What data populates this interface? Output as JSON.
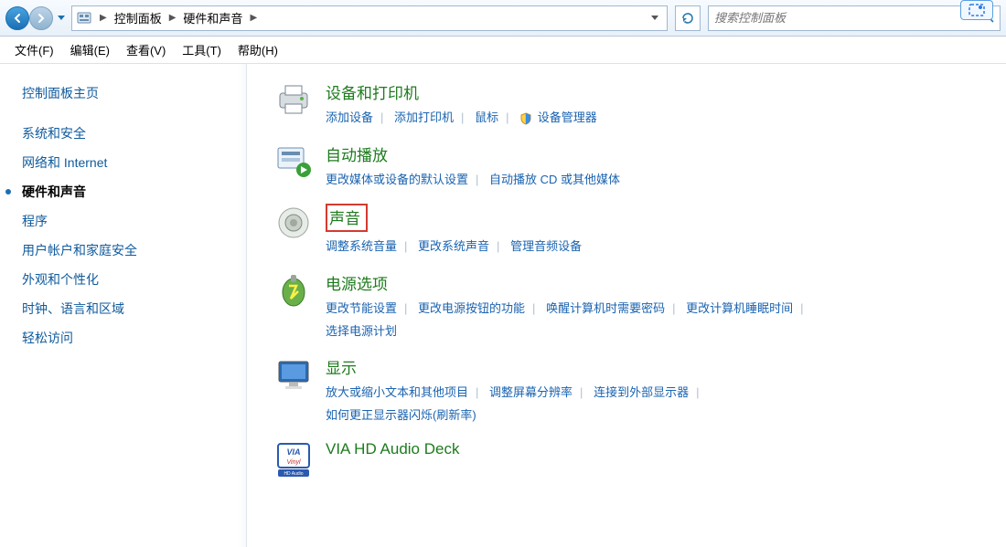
{
  "breadcrumb": {
    "items": [
      "控制面板",
      "硬件和声音"
    ]
  },
  "search": {
    "placeholder": "搜索控制面板"
  },
  "menubar": [
    "文件(F)",
    "编辑(E)",
    "查看(V)",
    "工具(T)",
    "帮助(H)"
  ],
  "sidebar": {
    "items": [
      {
        "label": "控制面板主页",
        "active": false
      },
      {
        "label": "系统和安全",
        "active": false
      },
      {
        "label": "网络和 Internet",
        "active": false
      },
      {
        "label": "硬件和声音",
        "active": true
      },
      {
        "label": "程序",
        "active": false
      },
      {
        "label": "用户帐户和家庭安全",
        "active": false
      },
      {
        "label": "外观和个性化",
        "active": false
      },
      {
        "label": "时钟、语言和区域",
        "active": false
      },
      {
        "label": "轻松访问",
        "active": false
      }
    ]
  },
  "categories": [
    {
      "icon": "printer-icon",
      "title": "设备和打印机",
      "highlighted": false,
      "links": [
        {
          "label": "添加设备"
        },
        {
          "label": "添加打印机"
        },
        {
          "label": "鼠标"
        },
        {
          "label": "设备管理器",
          "shield": true
        }
      ]
    },
    {
      "icon": "autoplay-icon",
      "title": "自动播放",
      "highlighted": false,
      "links": [
        {
          "label": "更改媒体或设备的默认设置"
        },
        {
          "label": "自动播放 CD 或其他媒体"
        }
      ]
    },
    {
      "icon": "speaker-icon",
      "title": "声音",
      "highlighted": true,
      "links": [
        {
          "label": "调整系统音量"
        },
        {
          "label": "更改系统声音"
        },
        {
          "label": "管理音频设备"
        }
      ]
    },
    {
      "icon": "power-icon",
      "title": "电源选项",
      "highlighted": false,
      "links": [
        {
          "label": "更改节能设置"
        },
        {
          "label": "更改电源按钮的功能"
        },
        {
          "label": "唤醒计算机时需要密码"
        },
        {
          "label": "更改计算机睡眠时间"
        },
        {
          "label": "选择电源计划"
        }
      ]
    },
    {
      "icon": "display-icon",
      "title": "显示",
      "highlighted": false,
      "links": [
        {
          "label": "放大或缩小文本和其他项目"
        },
        {
          "label": "调整屏幕分辨率"
        },
        {
          "label": "连接到外部显示器"
        },
        {
          "label": "如何更正显示器闪烁(刷新率)"
        }
      ]
    },
    {
      "icon": "via-icon",
      "title": "VIA HD Audio Deck",
      "highlighted": false,
      "links": []
    }
  ]
}
